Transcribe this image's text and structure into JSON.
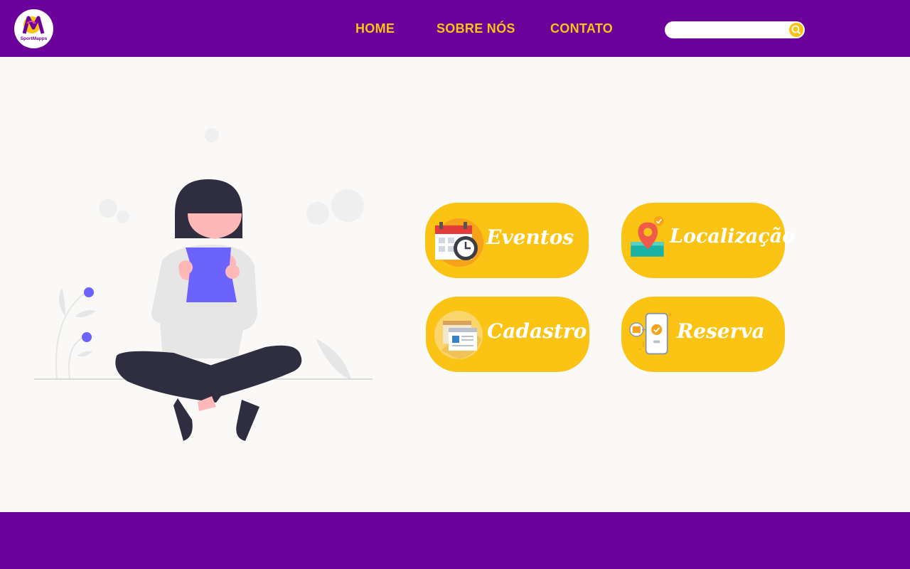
{
  "header": {
    "logo_text": "SportMapps",
    "nav": [
      {
        "label": "HOME"
      },
      {
        "label": "SOBRE NÓS"
      },
      {
        "label": "CONTATO"
      }
    ],
    "search": {
      "value": "",
      "placeholder": ""
    }
  },
  "cards": [
    {
      "label": "Eventos",
      "icon": "calendar-clock-icon"
    },
    {
      "label": "Localização",
      "icon": "location-pin-icon"
    },
    {
      "label": "Cadastro",
      "icon": "browser-form-icon"
    },
    {
      "label": "Reserva",
      "icon": "phone-check-icon"
    }
  ],
  "colors": {
    "brand_purple": "#6c009b",
    "accent_yellow": "#fbc313",
    "background": "#faf9f7",
    "illustration_accent": "#6c63ff"
  }
}
